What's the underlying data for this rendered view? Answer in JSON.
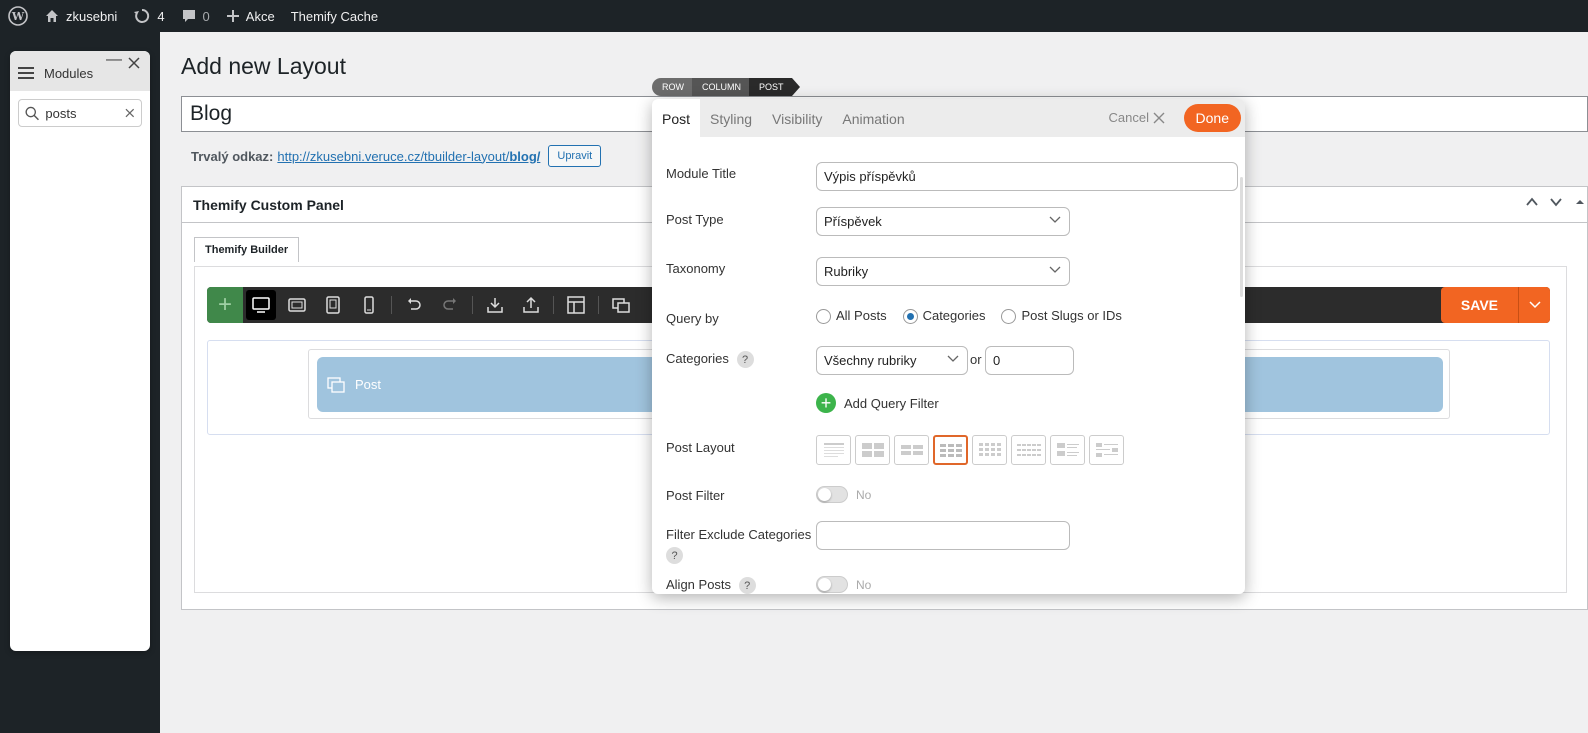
{
  "adminbar": {
    "site_name": "zkusebni",
    "updates_count": "4",
    "comments_count": "0",
    "new_label": "Akce",
    "cache_label": "Themify Cache"
  },
  "modules_panel": {
    "title": "Modules",
    "search_value": "posts"
  },
  "page": {
    "heading": "Add new Layout",
    "title_value": "Blog",
    "permalink_label": "Trvalý odkaz:",
    "permalink_url_base": "http://zkusebni.veruce.cz/tbuilder-layout/",
    "permalink_slug": "blog/",
    "edit_button": "Upravit"
  },
  "custom_panel": {
    "title": "Themify Custom Panel",
    "tab_label": "Themify Builder",
    "save_label": "SAVE",
    "module_label": "Post"
  },
  "breadcrumb": [
    "ROW",
    "COLUMN",
    "POST"
  ],
  "lightbox": {
    "tabs": [
      "Post",
      "Styling",
      "Visibility",
      "Animation"
    ],
    "cancel_label": "Cancel",
    "done_label": "Done",
    "fields": {
      "module_title_label": "Module Title",
      "module_title_value": "Výpis příspěvků",
      "post_type_label": "Post Type",
      "post_type_value": "Příspěvek",
      "taxonomy_label": "Taxonomy",
      "taxonomy_value": "Rubriky",
      "query_by_label": "Query by",
      "query_options": [
        "All Posts",
        "Categories",
        "Post Slugs or IDs"
      ],
      "query_selected": "Categories",
      "categories_label": "Categories",
      "categories_value": "Všechny rubriky",
      "categories_or": "or",
      "categories_id": "0",
      "add_query_filter": "Add Query Filter",
      "post_layout_label": "Post Layout",
      "post_filter_label": "Post Filter",
      "post_filter_state": "No",
      "filter_exclude_label": "Filter Exclude Categories",
      "filter_exclude_value": "",
      "align_posts_label": "Align Posts",
      "align_posts_state": "No"
    }
  },
  "colors": {
    "accent": "#f26522",
    "admin_dark": "#1d2327",
    "module_bg": "#a0c4de",
    "toolbar_green": "#40884a"
  }
}
